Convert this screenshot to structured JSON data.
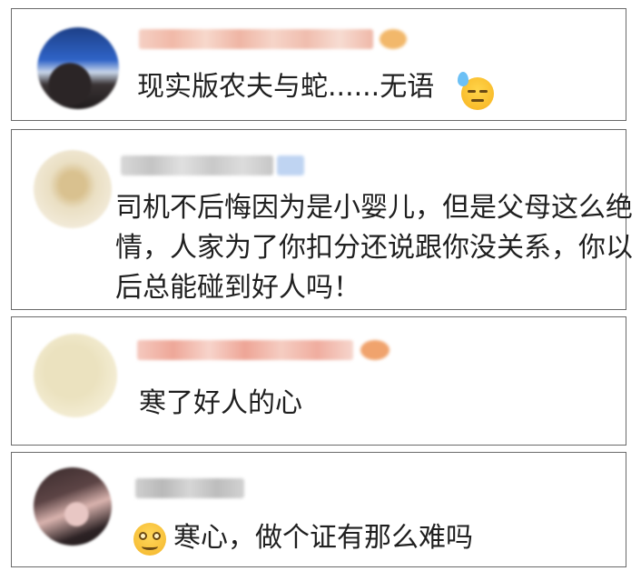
{
  "comments": [
    {
      "text": "现实版农夫与蛇......无语",
      "emoji": "sweat-smile-icon"
    },
    {
      "lines": [
        "司机不后悔因为是小婴儿，但是父母这么绝",
        "情，人家为了你扣分还说跟你没关系，你以",
        "后总能碰到好人吗！"
      ]
    },
    {
      "text": "寒了好人的心"
    },
    {
      "text": "寒心，做个证有那么难吗",
      "emoji": "weeping-smile-icon"
    }
  ]
}
